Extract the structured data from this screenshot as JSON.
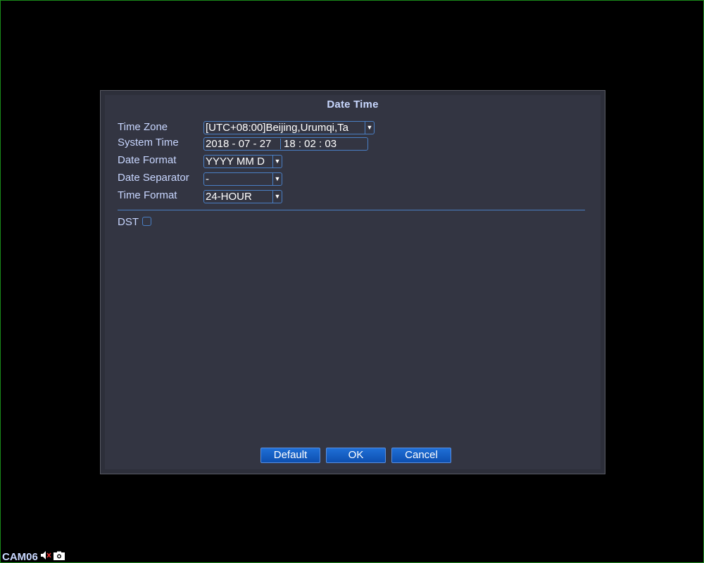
{
  "dialog": {
    "title": "Date Time"
  },
  "fields": {
    "time_zone": {
      "label": "Time Zone",
      "value": "[UTC+08:00]Beijing,Urumqi,Ta"
    },
    "system_time": {
      "label": "System Time",
      "date": "2018 - 07 - 27",
      "time": "18 : 02 : 03"
    },
    "date_format": {
      "label": "Date Format",
      "value": "YYYY MM D"
    },
    "date_separator": {
      "label": "Date Separator",
      "value": "-"
    },
    "time_format": {
      "label": "Time Format",
      "value": "24-HOUR"
    },
    "dst": {
      "label": "DST",
      "checked": false
    }
  },
  "buttons": {
    "default": "Default",
    "ok": "OK",
    "cancel": "Cancel"
  },
  "status_bar": {
    "camera": "CAM06",
    "icons": [
      "mute-icon",
      "camera-icon"
    ]
  },
  "colors": {
    "accent": "#4a7fc4",
    "label": "#c8d6ff",
    "button": "#1f6fd6",
    "panel": "#333542"
  }
}
